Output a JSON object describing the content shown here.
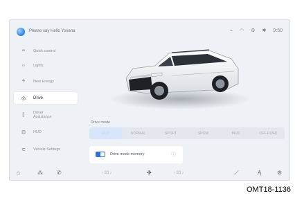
{
  "topbar": {
    "voice_prompt": "Please say Hello Yooana",
    "time": "9:50"
  },
  "sidebar": {
    "items": [
      {
        "icon": "seat-icon",
        "label": "Quick control"
      },
      {
        "icon": "light-icon",
        "label": "Lights"
      },
      {
        "icon": "energy-icon",
        "label": "New Energy"
      },
      {
        "icon": "drive-icon",
        "label": "Drive"
      },
      {
        "icon": "driver-assist-icon",
        "label": "Driver Assistance"
      },
      {
        "icon": "hud-icon",
        "label": "HUD"
      },
      {
        "icon": "vehicle-settings-icon",
        "label": "Vehicle Settings"
      }
    ],
    "active_index": 3
  },
  "drive_mode": {
    "label": "Drive mode",
    "modes": [
      "ECO",
      "NORMAL",
      "SPORT",
      "SNOW",
      "MUD",
      "OFF-ROAD"
    ],
    "selected_index": 0
  },
  "card": {
    "label": "Drive mode memory",
    "toggle_on": true
  },
  "bottombar": {
    "left_temp": "‹ 20 ›",
    "right_temp": "‹ 20 ›"
  },
  "reference": "OMT18-1136",
  "colors": {
    "accent": "#2f6fd6",
    "screen_bg": "#eef1f5"
  }
}
